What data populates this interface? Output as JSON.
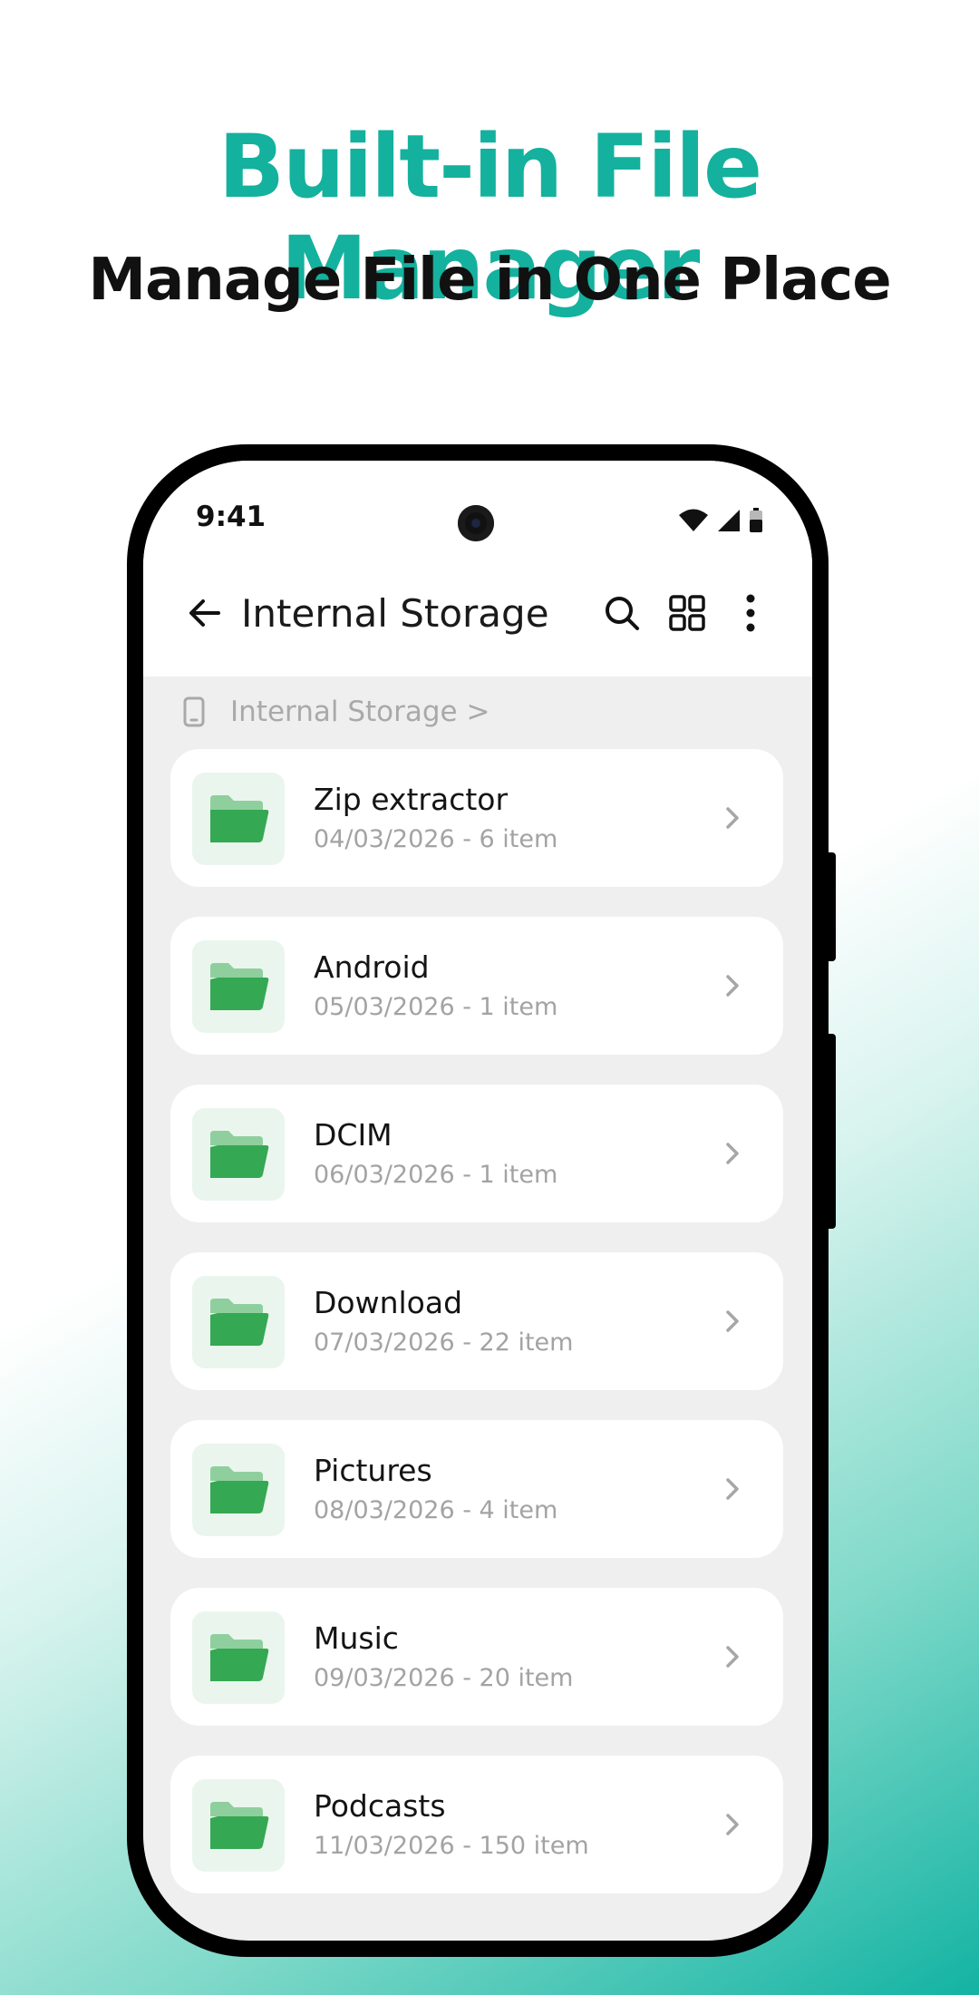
{
  "banner": {
    "title": "Built-in File Manager",
    "subtitle": "Manage File in One Place"
  },
  "status": {
    "time": "9:41"
  },
  "app": {
    "title": "Internal Storage",
    "breadcrumb": "Internal Storage >"
  },
  "colors": {
    "accent": "#14b19e",
    "folder": "#35a853",
    "folder_light": "#8fcf9e"
  },
  "folders": [
    {
      "name": "Zip extractor",
      "meta": "04/03/2026 - 6 item"
    },
    {
      "name": "Android",
      "meta": "05/03/2026 - 1 item"
    },
    {
      "name": "DCIM",
      "meta": "06/03/2026 - 1 item"
    },
    {
      "name": "Download",
      "meta": "07/03/2026 - 22 item"
    },
    {
      "name": "Pictures",
      "meta": "08/03/2026 - 4 item"
    },
    {
      "name": "Music",
      "meta": "09/03/2026 - 20 item"
    },
    {
      "name": "Podcasts",
      "meta": "11/03/2026 - 150 item"
    }
  ]
}
